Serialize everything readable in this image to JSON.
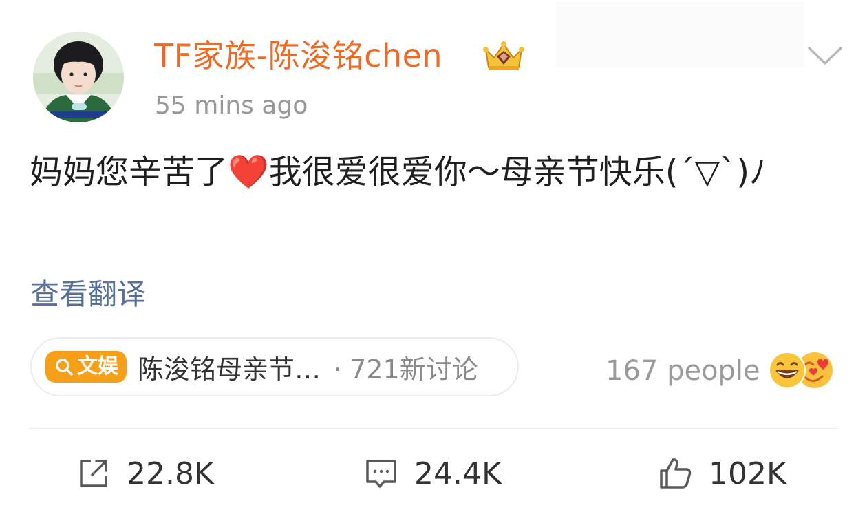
{
  "post": {
    "author": "TF家族-陈浚铭chen",
    "timestamp": "55 mins ago",
    "text": "妈妈您辛苦了",
    "text_emoji": "❤️",
    "text_rest": "我很爱很爱你～母亲节快乐(´▽`)ﾉ",
    "translate_label": "查看翻译"
  },
  "topic": {
    "tag_label": "文娱",
    "title": "陈浚铭母亲节…",
    "meta": "· 721新讨论"
  },
  "reactions": {
    "count_label": "167 people"
  },
  "actions": {
    "share_count": "22.8K",
    "comment_count": "24.4K",
    "like_count": "102K"
  },
  "icons": [
    "crown-icon",
    "chevron-down-icon",
    "search-icon",
    "share-icon",
    "comment-icon",
    "like-icon",
    "laughing-emoji-icon",
    "love-emoji-icon"
  ],
  "colors": {
    "author": "#ef6a25",
    "timestamp": "#999999",
    "link": "#56709a",
    "tag": "#f6a01a",
    "heart": "#e8353a"
  }
}
